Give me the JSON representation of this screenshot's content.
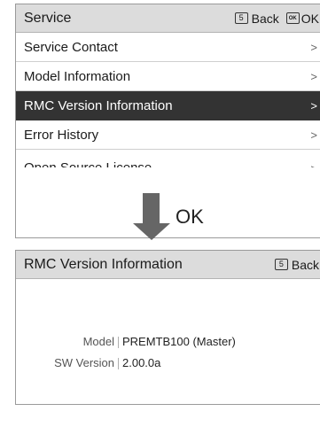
{
  "top_screen": {
    "title": "Service",
    "back_label": "Back",
    "ok_key_glyph": "OK",
    "ok_label": "OK",
    "back_key_glyph": "5",
    "menu": [
      {
        "label": "Service Contact",
        "selected": false
      },
      {
        "label": "Model Information",
        "selected": false
      },
      {
        "label": "RMC Version Information",
        "selected": true
      },
      {
        "label": "Error History",
        "selected": false
      },
      {
        "label": "Open Source License",
        "selected": false
      }
    ],
    "chevron": ">"
  },
  "transition": {
    "label": "OK"
  },
  "bottom_screen": {
    "title": "RMC Version Information",
    "back_label": "Back",
    "back_key_glyph": "5",
    "fields": [
      {
        "label": "Model",
        "value": "PREMTB100 (Master)"
      },
      {
        "label": "SW Version",
        "value": "2.00.0a"
      }
    ]
  },
  "colors": {
    "header_bg": "#dcdcdc",
    "selected_bg": "#333333",
    "arrow": "#666666"
  }
}
